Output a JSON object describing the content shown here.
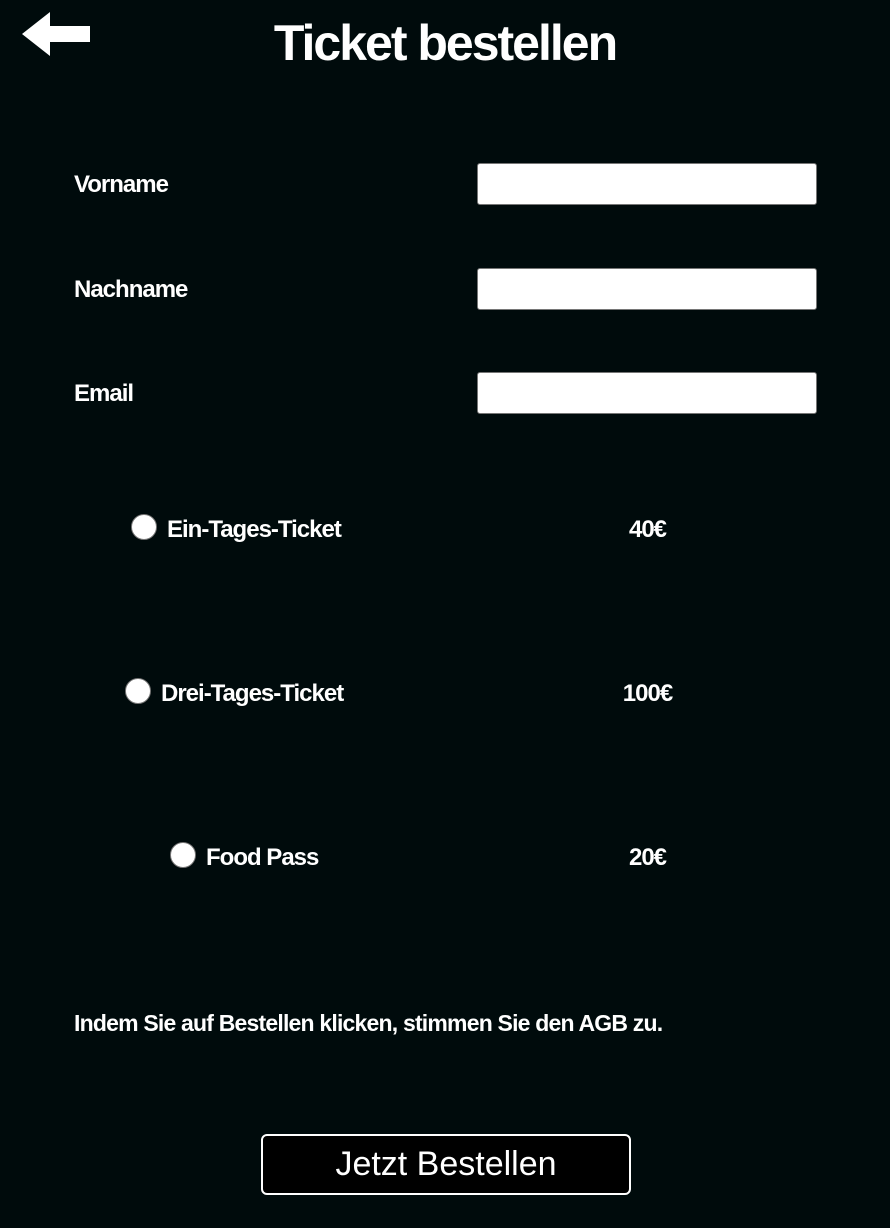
{
  "header": {
    "back_icon": "arrow-left-icon",
    "title": "Ticket bestellen"
  },
  "form": {
    "fields": [
      {
        "label": "Vorname",
        "value": "",
        "placeholder": ""
      },
      {
        "label": "Nachname",
        "value": "",
        "placeholder": ""
      },
      {
        "label": "Email",
        "value": "",
        "placeholder": ""
      }
    ],
    "options": [
      {
        "label": "Ein-Tages-Ticket",
        "price": "40€",
        "selected": false
      },
      {
        "label": "Drei-Tages-Ticket",
        "price": "100€",
        "selected": false
      },
      {
        "label": "Food Pass",
        "price": "20€",
        "selected": false
      }
    ],
    "terms": "Indem Sie auf Bestellen klicken, stimmen Sie den AGB zu.",
    "submit_label": "Jetzt Bestellen"
  },
  "colors": {
    "background": "#000b0c",
    "text": "#ffffff",
    "input_background": "#ffffff"
  }
}
